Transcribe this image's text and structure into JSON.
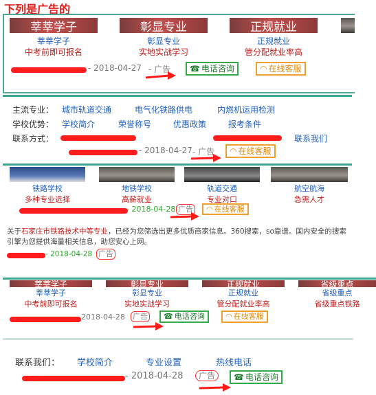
{
  "page_title": "下列是广告的",
  "ad1": {
    "banners": [
      "莘莘学子",
      "彰显专业",
      "正规就业"
    ],
    "cols": [
      {
        "title": "莘莘学子",
        "sub": "中考前即可报名"
      },
      {
        "title": "彰显专业",
        "sub": "实地实战学习"
      },
      {
        "title": "正规就业",
        "sub": "管分配就业率高"
      }
    ],
    "date": "- 2018-04-27",
    "ad_label": "- 广告",
    "btn_phone": "电话咨询",
    "btn_online": "在线客服"
  },
  "ad2": {
    "row1_label": "主流专业：",
    "row1_links": [
      "城市轨道交通",
      "电气化铁路供电",
      "内燃机运用检测"
    ],
    "row2_label": "学校优势：",
    "row2_links": [
      "学校简介",
      "荣誉称号",
      "优惠政策",
      "报考条件"
    ],
    "row3_label": "联系方式：",
    "row3_link": "联系我们",
    "date": "- 2018-04-27",
    "ad_label": "- 广告",
    "btn_online": "在线客服"
  },
  "ad3": {
    "cols": [
      {
        "title": "铁路学校",
        "sub": "多种专业选择"
      },
      {
        "title": "地铁学校",
        "sub": "高薪就业"
      },
      {
        "title": "轨道交通",
        "sub": "专业对口"
      },
      {
        "title": "航空航海",
        "sub": "急需人才"
      }
    ],
    "date": "- 2018-04-28",
    "ad_label": "广告",
    "btn_online": "在线客服"
  },
  "ad4": {
    "text_prefix": "关于",
    "text_highlight": "石家庄市铁路技术中等专业",
    "text_rest": "，已经为您筛选出更多优质商家信息。360搜索，so靠谱。国内安全的搜索引擎为您提供海量相关信息，助您安心上网。",
    "date": "- 2018-04-28",
    "ad_label": "广告"
  },
  "ad5": {
    "banners": [
      "莘莘学子",
      "彰显专业",
      "正规就业",
      "省级重点"
    ],
    "cols": [
      {
        "title": "莘莘学子",
        "sub": "中考前即可报名"
      },
      {
        "title": "彰显专业",
        "sub": "实地实战学习"
      },
      {
        "title": "正规就业",
        "sub": "管分配就业率高"
      },
      {
        "title": "省级重点",
        "sub": "省级重点铁路"
      }
    ],
    "date": "2018-04-28",
    "ad_label": "广告",
    "btn_phone": "电话咨询",
    "btn_online": "在线客服"
  },
  "ad6": {
    "label": "联系我们：",
    "links": [
      "学校简介",
      "专业设置",
      "热线电话"
    ],
    "date": "- 2018-04-28",
    "ad_label": "广告",
    "btn_phone": "电话咨询"
  },
  "colors": {
    "teal": "#3fa392",
    "red_mark": "#ff1010",
    "green": "#37a84a",
    "orange": "#f0a030"
  }
}
